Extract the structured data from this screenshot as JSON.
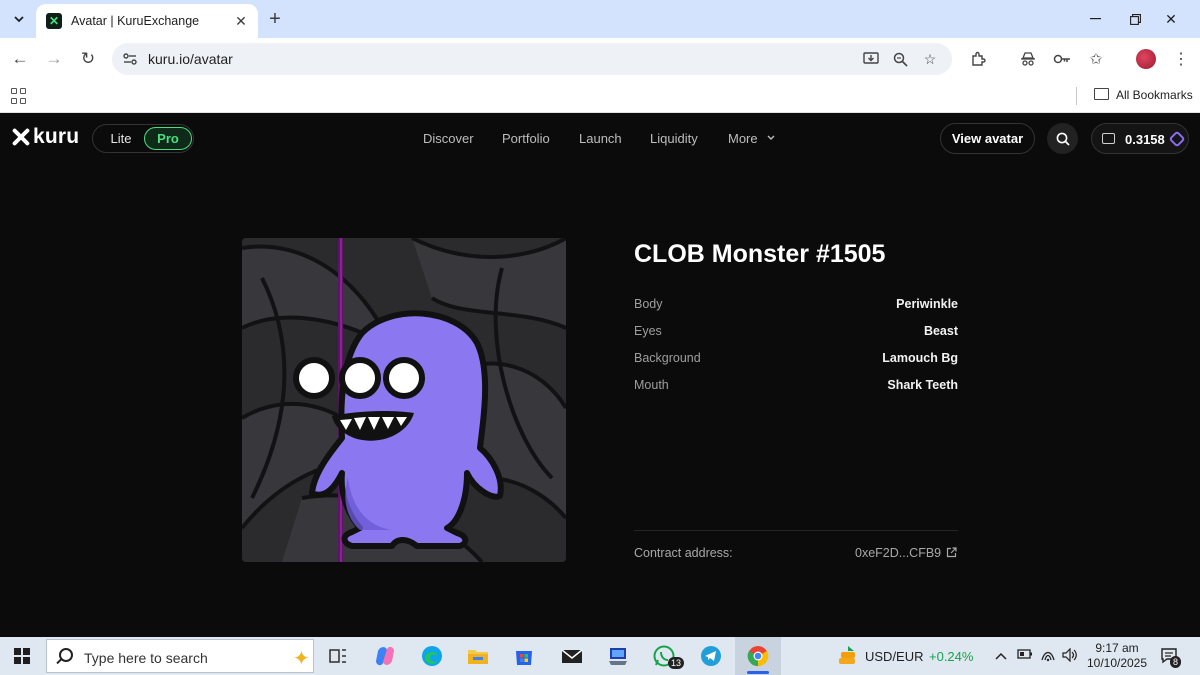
{
  "browser": {
    "tab_title": "Avatar | KuruExchange",
    "url": "kuru.io/avatar",
    "bookmarks_label": "All Bookmarks"
  },
  "header": {
    "logo_text": "kuru",
    "mode_lite": "Lite",
    "mode_pro": "Pro",
    "nav": [
      "Discover",
      "Portfolio",
      "Launch",
      "Liquidity",
      "More"
    ],
    "view_avatar": "View avatar",
    "balance": "0.3158"
  },
  "avatar": {
    "title": "CLOB Monster #1505",
    "traits": [
      {
        "key": "Body",
        "value": "Periwinkle"
      },
      {
        "key": "Eyes",
        "value": "Beast"
      },
      {
        "key": "Background",
        "value": "Lamouch Bg"
      },
      {
        "key": "Mouth",
        "value": "Shark Teeth"
      }
    ],
    "contract_label": "Contract address:",
    "contract_value": "0xeF2D...CFB9"
  },
  "taskbar": {
    "search_placeholder": "Type here to search",
    "whatsapp_badge": "13",
    "ticker_label": "USD/EUR",
    "ticker_change": "+0.24%",
    "time": "9:17 am",
    "date": "10/10/2025",
    "notification_count": "8"
  },
  "colors": {
    "accent_green": "#4ade80",
    "monster_purple": "#8b78f0",
    "page_bg": "#0b0b0c"
  }
}
